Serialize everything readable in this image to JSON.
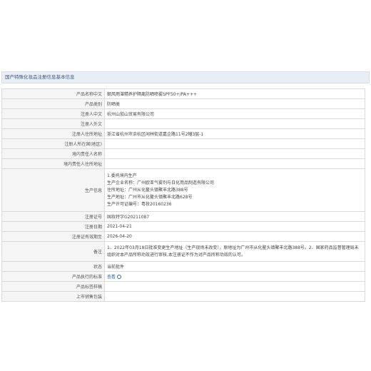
{
  "page": {
    "section_title": "国产特殊化妆品注册信息基本信息"
  },
  "rows": [
    {
      "label": "产品名称中文",
      "value": "朝风雨湛精养护隔离防晒喷雾SPF50+/PA+++"
    },
    {
      "label": "产品类别",
      "value": "防晒类"
    },
    {
      "label": "注册人中文",
      "value": "杭州山茄山贸易有限公司"
    },
    {
      "label": "注册人外文",
      "value": ""
    },
    {
      "label": "注册人住所地址",
      "value": "浙江省杭州市余杭区闲林街道嘉企路11号2幢3层-1"
    },
    {
      "label": "注册人所在国(地区)",
      "value": ""
    },
    {
      "label": "境内责任人名称",
      "value": ""
    },
    {
      "label": "境内责任人住所地址",
      "value": ""
    },
    {
      "label": "生产信息",
      "lines": [
        "1.委托境内生产",
        "生产企业名称：广州欧亚气雾剂与日化用品制造有限公司",
        "住所地址：广州从化鳌头镇聚丰北路388号",
        "生产地址：广州市从化鳌头镇聚丰北路628号",
        "生产许可证编号：粤妆20160236"
      ]
    },
    {
      "label": "注册证号",
      "value": "国妆特字G20211087"
    },
    {
      "label": "注册日期",
      "value": "2021-04-21"
    },
    {
      "label": "注册证有效期至",
      "value": "2026-04-20"
    },
    {
      "label": "备注",
      "lines": [
        "1、2022年03月18日批准变更生产地址（生产现场未改变），原地址为广州市从化鳌头镇聚丰北路388号。2、国家药品监督管理局未",
        "组织对本产品所称功效进行审核,本注册证不作为对产品所称功效的认可。"
      ]
    },
    {
      "label": "状态",
      "value": "当前批件"
    },
    {
      "label": "产品执行的标准",
      "link": "查看"
    },
    {
      "label": "产品标签样稿",
      "value": ""
    },
    {
      "label": "上市销售包装",
      "value": ""
    }
  ]
}
